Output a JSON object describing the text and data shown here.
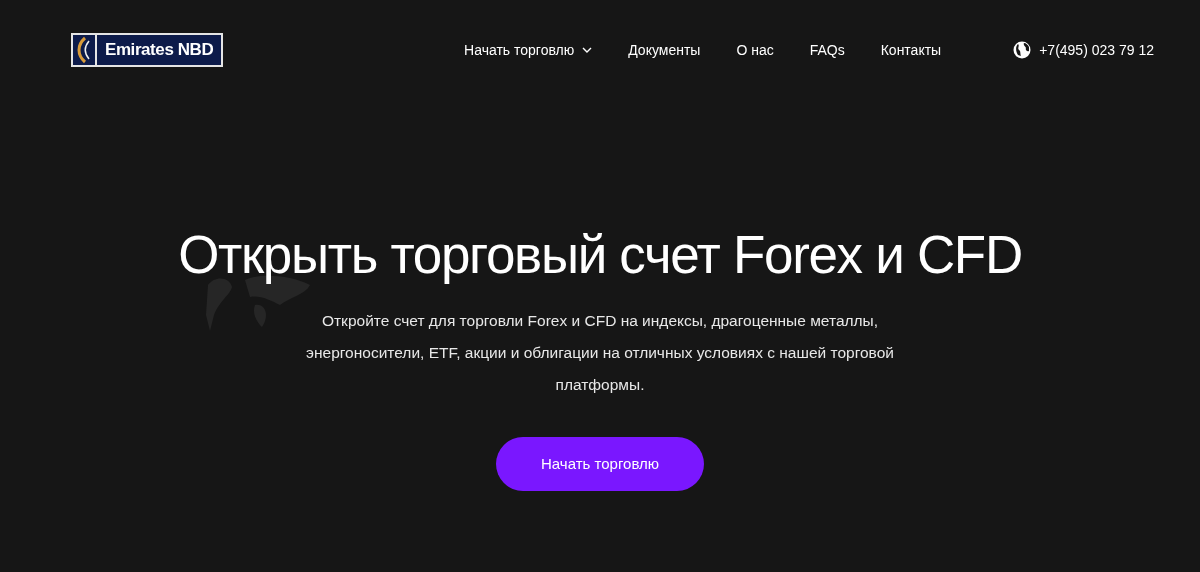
{
  "logo": {
    "text": "Emirates NBD"
  },
  "nav": [
    {
      "label": "Начать торговлю",
      "dropdown": true
    },
    {
      "label": "Документы",
      "dropdown": false
    },
    {
      "label": "О нас",
      "dropdown": false
    },
    {
      "label": "FAQs",
      "dropdown": false
    },
    {
      "label": "Контакты",
      "dropdown": false
    }
  ],
  "phone": "+7(495) 023 79 12",
  "hero": {
    "title": "Открыть торговый счет Forex и CFD",
    "text": "Откройте счет для торговли Forex и CFD на индексы, драгоценные металлы, энергоносители, ETF, акции и облигации на отличных условиях с нашей торговой платформы.",
    "button": "Начать торговлю"
  }
}
